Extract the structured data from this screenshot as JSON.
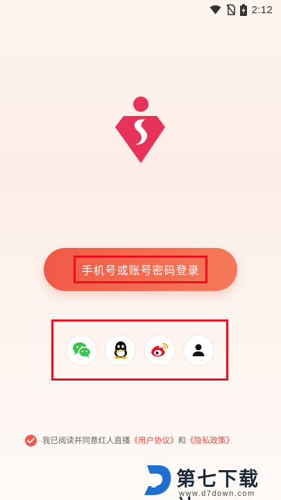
{
  "status_bar": {
    "time": "2:12",
    "icons": [
      "wifi-icon",
      "no-sim-icon",
      "battery-charging-icon"
    ]
  },
  "logo": {
    "name": "diamond-logo",
    "color": "#e8325a"
  },
  "login": {
    "label": "手机号或账号密码登录"
  },
  "social_login": [
    {
      "name": "wechat-icon"
    },
    {
      "name": "qq-icon"
    },
    {
      "name": "weibo-icon"
    },
    {
      "name": "account-icon"
    }
  ],
  "agreement": {
    "prefix": "我已阅读并同意红人直播",
    "user_agreement": "《用户协议》",
    "and": "和",
    "privacy_policy": "《隐私政策》"
  },
  "watermark": {
    "title": "第七下载站",
    "url": "www.d7down.com"
  },
  "colors": {
    "accent": "#f05a47",
    "highlight_border": "#e8101e",
    "link": "#e8453c"
  }
}
